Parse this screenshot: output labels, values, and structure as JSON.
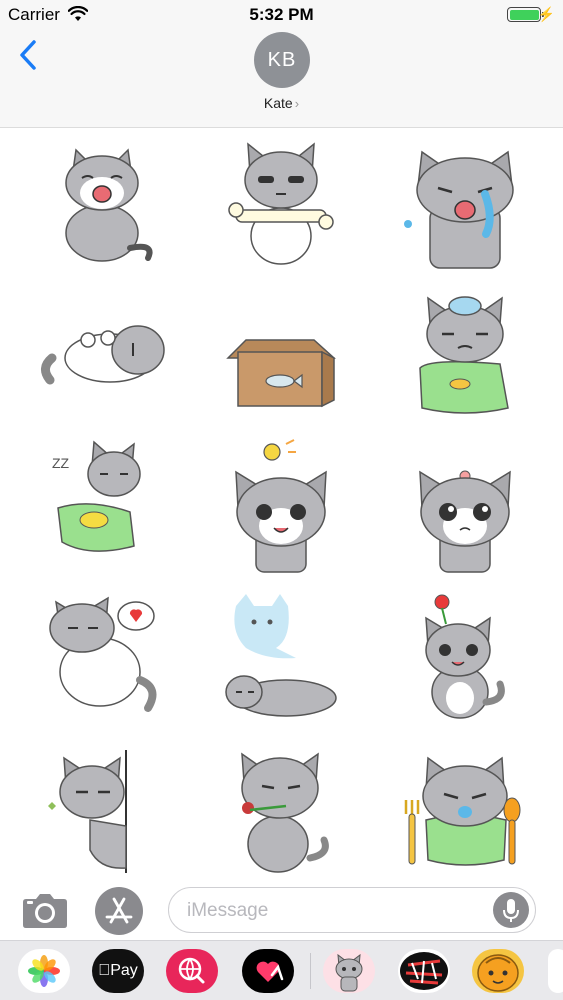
{
  "status_bar": {
    "carrier": "Carrier",
    "time": "5:32 PM",
    "battery_level": 1.0
  },
  "conversation": {
    "avatar_initials": "KB",
    "contact_name": "Kate",
    "contact_chevron": "›"
  },
  "stickers": [
    {
      "name": "cat-crying-sitting"
    },
    {
      "name": "cat-holding-bone"
    },
    {
      "name": "cat-tears"
    },
    {
      "name": "cat-lying-on-back"
    },
    {
      "name": "cat-hiding-in-box"
    },
    {
      "name": "cat-sick-ice-pack"
    },
    {
      "name": "cat-sleeping-blanket"
    },
    {
      "name": "cat-idea-lightbulb"
    },
    {
      "name": "cat-teary-eyes"
    },
    {
      "name": "cat-love-heart"
    },
    {
      "name": "cat-ghost-spirit"
    },
    {
      "name": "cat-with-flower"
    },
    {
      "name": "cat-peeking-wall"
    },
    {
      "name": "cat-with-rose"
    },
    {
      "name": "cat-with-fork-spoon"
    }
  ],
  "compose": {
    "placeholder": "iMessage"
  },
  "app_drawer": {
    "apps": [
      {
        "name": "photos-app",
        "icon": "photos-icon"
      },
      {
        "name": "apple-pay-app",
        "label": "Pay",
        "icon": "apple-pay-icon"
      },
      {
        "name": "search-images-app",
        "icon": "globe-search-icon"
      },
      {
        "name": "digital-touch-app",
        "icon": "heart-touch-icon"
      },
      {
        "name": "cat-sticker-app",
        "icon": "cat-sticker-icon"
      },
      {
        "name": "text-sticker-app",
        "icon": "graffiti-sticker-icon"
      },
      {
        "name": "orange-sticker-app",
        "icon": "orange-character-icon"
      }
    ]
  },
  "colors": {
    "ios_blue": "#1a7cf6",
    "battery_green": "#3fd15b",
    "avatar_gray": "#8e9196",
    "cat_gray": "#a9a9ad",
    "cat_pink": "#f5c0c8"
  }
}
